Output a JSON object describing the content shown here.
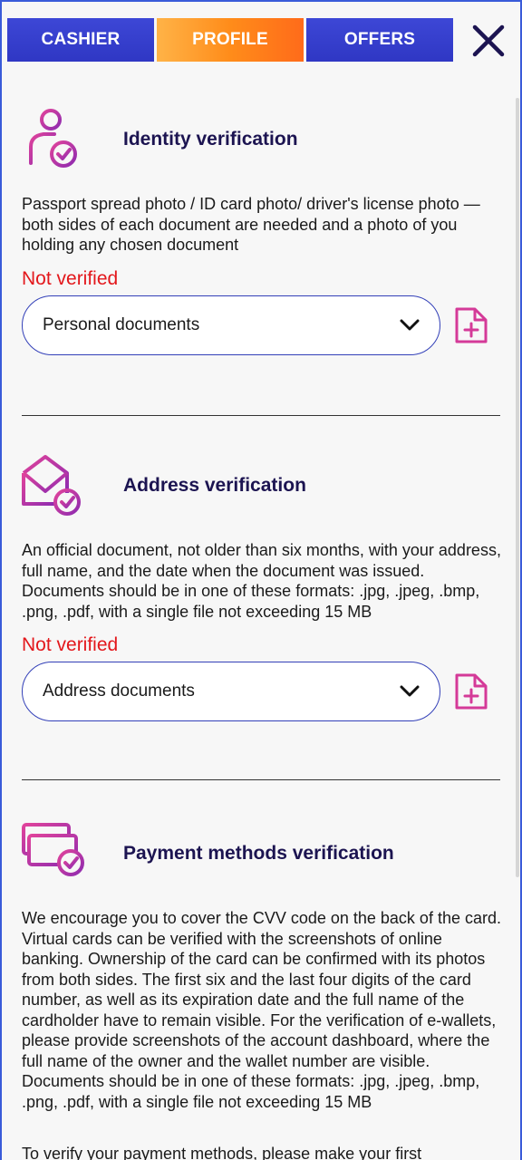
{
  "tabs": [
    {
      "label": "CASHIER"
    },
    {
      "label": "PROFILE"
    },
    {
      "label": "OFFERS"
    }
  ],
  "close_icon": "close-x-icon",
  "colors": {
    "tab_blue": "#3d47d6",
    "tab_active_orange": "#ff8c1a",
    "accent_magenta": "#c2308f",
    "status_red": "#e3171b",
    "title_navy": "#1c1451"
  },
  "identity": {
    "icon": "person-check-icon",
    "title": "Identity verification",
    "description": "Passport spread photo / ID card photo/ driver's license photo — both sides of each document are needed and a photo of you holding any chosen document",
    "status": "Not verified",
    "select_value": "Personal documents"
  },
  "address": {
    "icon": "envelope-check-icon",
    "title": "Address verification",
    "description": "An official document, not older than six months, with your address, full name, and the date when the document was issued. Documents should be in one of these formats: .jpg, .jpeg, .bmp, .png, .pdf, with a single file not exceeding 15 MB",
    "status": "Not verified",
    "select_value": "Address documents"
  },
  "payment": {
    "icon": "cards-check-icon",
    "title": "Payment methods verification",
    "description": "We encourage you to cover the CVV code on the back of the card. Virtual cards can be verified with the screenshots of online banking. Ownership of the card can be confirmed with its photos from both sides. The first six and the last four digits of the card number, as well as its expiration date and the full name of the cardholder have to remain visible. For the verification of e-wallets, please provide screenshots of the account dashboard, where the full name of the owner and the wallet number are visible. Documents should be in one of these formats: .jpg, .jpeg, .bmp, .png, .pdf, with a single file not exceeding 15 MB",
    "note": "To verify your payment methods, please make your first"
  }
}
